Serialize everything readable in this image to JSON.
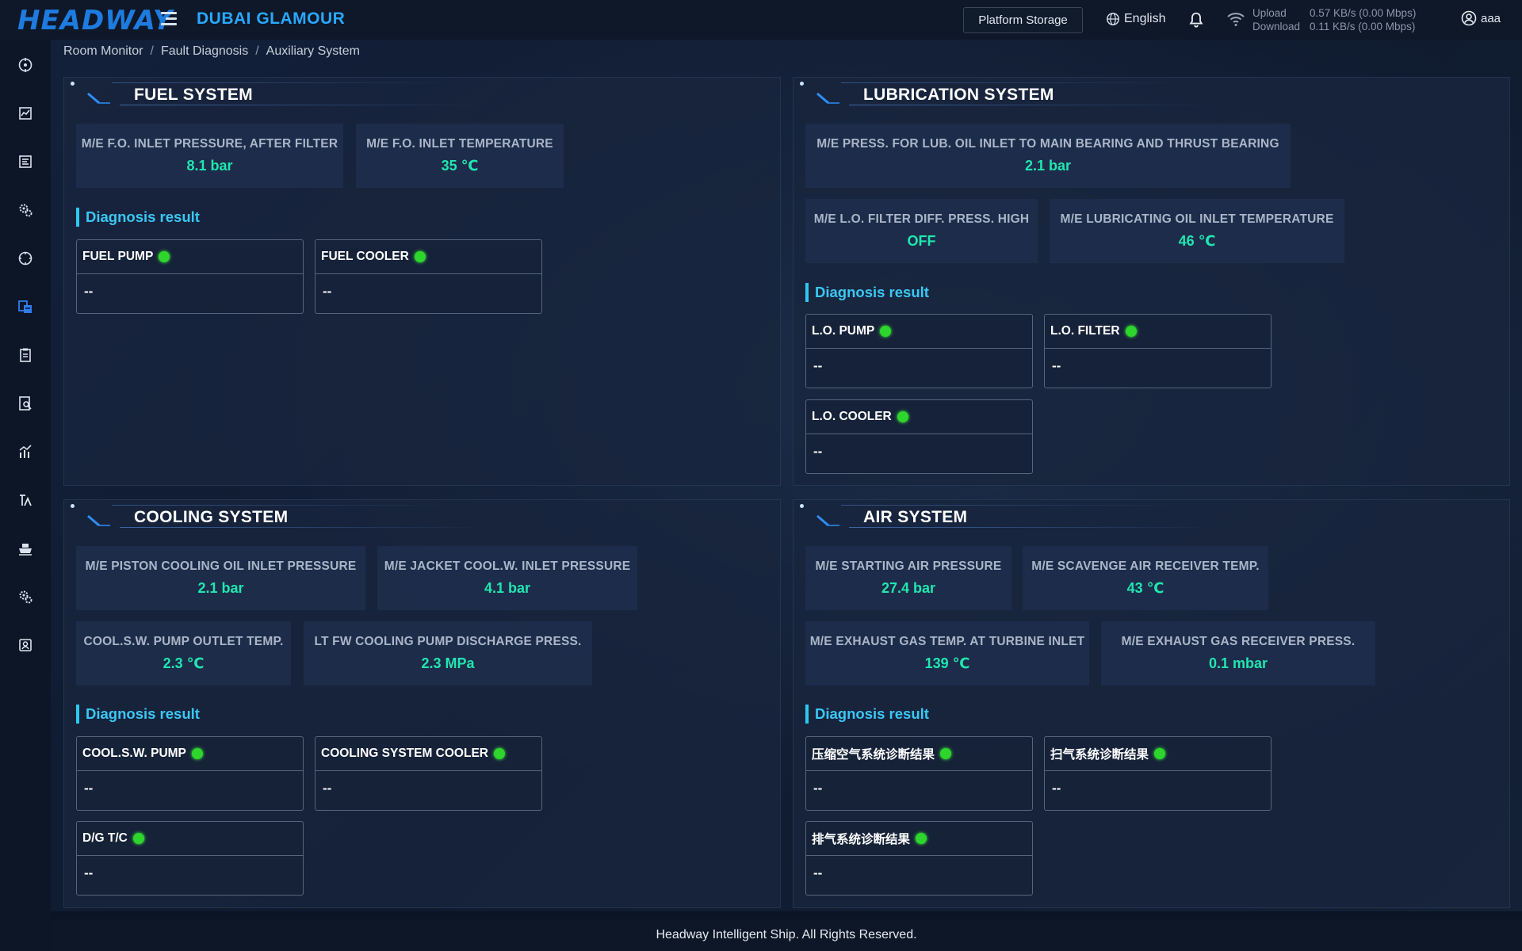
{
  "header": {
    "logo": "HEADWAY",
    "ship_name": "DUBAI GLAMOUR",
    "storage_button": "Platform Storage",
    "language": "English",
    "upload_label": "Upload",
    "upload_value": "0.57 KB/s (0.00 Mbps)",
    "download_label": "Download",
    "download_value": "0.11 KB/s (0.00 Mbps)",
    "user": "aaa"
  },
  "breadcrumb": [
    "Room Monitor",
    "Fault Diagnosis",
    "Auxiliary System"
  ],
  "sidebar": [
    "target-icon",
    "chart-icon",
    "report-icon",
    "gears-icon",
    "compass-icon",
    "diagnosis-icon",
    "clipboard-icon",
    "search-doc-icon",
    "trend-icon",
    "tools-icon",
    "ship-icon",
    "settings-icon",
    "user-card-icon"
  ],
  "panels": {
    "fuel": {
      "title": "FUEL SYSTEM",
      "metrics": [
        {
          "label": "M/E F.O. INLET PRESSURE, AFTER FILTER",
          "value": "8.1 bar"
        },
        {
          "label": "M/E F.O. INLET TEMPERATURE",
          "value": "35 ℃"
        }
      ],
      "diag_title": "Diagnosis result",
      "cards": [
        {
          "name": "FUEL PUMP",
          "result": "--"
        },
        {
          "name": "FUEL COOLER",
          "result": "--"
        }
      ]
    },
    "lube": {
      "title": "LUBRICATION SYSTEM",
      "metrics": [
        {
          "label": "M/E PRESS. FOR LUB. OIL INLET TO MAIN BEARING AND THRUST BEARING",
          "value": "2.1 bar"
        },
        {
          "label": "M/E L.O. FILTER DIFF. PRESS. HIGH",
          "value": "OFF"
        },
        {
          "label": "M/E LUBRICATING OIL INLET TEMPERATURE",
          "value": "46 ℃"
        }
      ],
      "diag_title": "Diagnosis result",
      "cards": [
        {
          "name": "L.O. PUMP",
          "result": "--"
        },
        {
          "name": "L.O. FILTER",
          "result": "--"
        },
        {
          "name": "L.O. COOLER",
          "result": "--"
        }
      ]
    },
    "cooling": {
      "title": "COOLING SYSTEM",
      "metrics": [
        {
          "label": "M/E PISTON COOLING OIL INLET PRESSURE",
          "value": "2.1 bar"
        },
        {
          "label": "M/E JACKET COOL.W. INLET PRESSURE",
          "value": "4.1 bar"
        },
        {
          "label": "COOL.S.W. PUMP OUTLET TEMP.",
          "value": "2.3 ℃"
        },
        {
          "label": "LT FW COOLING PUMP DISCHARGE PRESS.",
          "value": "2.3 MPa"
        }
      ],
      "diag_title": "Diagnosis result",
      "cards": [
        {
          "name": "COOL.S.W. PUMP",
          "result": "--"
        },
        {
          "name": "COOLING SYSTEM COOLER",
          "result": "--"
        },
        {
          "name": "D/G T/C",
          "result": "--"
        }
      ]
    },
    "air": {
      "title": "AIR SYSTEM",
      "metrics": [
        {
          "label": "M/E STARTING AIR PRESSURE",
          "value": "27.4 bar"
        },
        {
          "label": "M/E SCAVENGE AIR RECEIVER TEMP.",
          "value": "43 ℃"
        },
        {
          "label": "M/E EXHAUST GAS TEMP. AT TURBINE INLET",
          "value": "139 ℃"
        },
        {
          "label": "M/E EXHAUST GAS RECEIVER PRESS.",
          "value": "0.1 mbar"
        }
      ],
      "diag_title": "Diagnosis result",
      "cards": [
        {
          "name": "压缩空气系统诊断结果",
          "result": "--"
        },
        {
          "name": "扫气系统诊断结果",
          "result": "--"
        },
        {
          "name": "排气系统诊断结果",
          "result": "--"
        }
      ]
    }
  },
  "footer": "Headway Intelligent Ship. All Rights Reserved.",
  "colors": {
    "accent": "#29a8ff",
    "value": "#21e6b0",
    "status_ok": "#2ed52c"
  }
}
